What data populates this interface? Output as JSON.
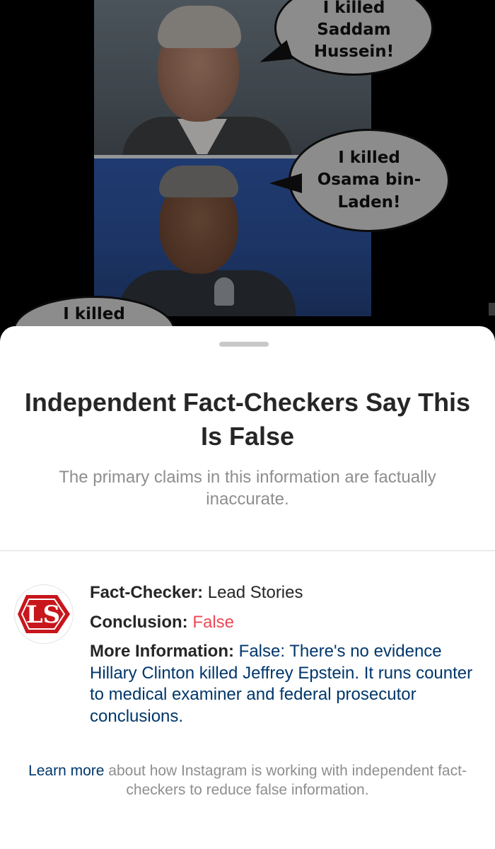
{
  "meme": {
    "bubbles": [
      "I killed\nSaddam\nHussein!",
      "I killed\nOsama bin-\nLaden!",
      "I killed"
    ]
  },
  "sheet": {
    "title": "Independent Fact-Checkers Say This Is False",
    "subtitle": "The primary claims in this information are factually inaccurate."
  },
  "fact_check": {
    "logo_text": "LS",
    "checker_label": "Fact-Checker:",
    "checker_value": "Lead Stories",
    "conclusion_label": "Conclusion:",
    "conclusion_value": "False",
    "more_info_label": "More Information:",
    "more_info_value": "False: There's no evidence Hillary Clinton killed Jeffrey Epstein. It runs counter to medical examiner and federal prosecutor conclusions."
  },
  "footer": {
    "link_text": "Learn more",
    "text": " about how Instagram is working with independent fact-checkers to reduce false information."
  },
  "colors": {
    "false_red": "#ed4956",
    "link_blue": "#00376b",
    "secondary_gray": "#8e8e8e",
    "logo_red": "#c8161d"
  }
}
